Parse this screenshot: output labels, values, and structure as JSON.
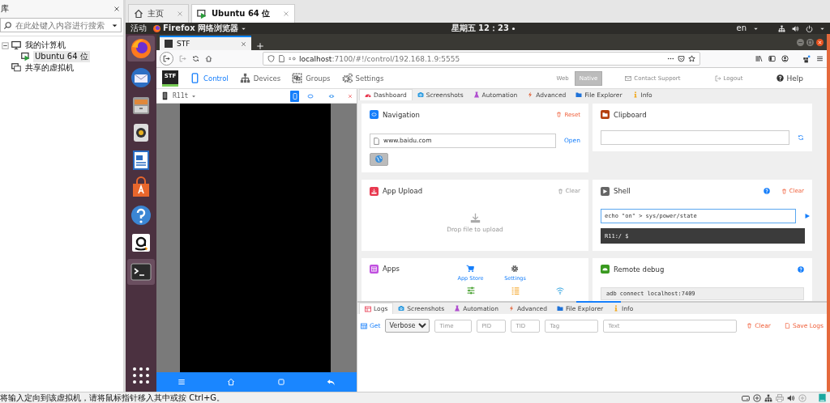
{
  "library": {
    "title": "库",
    "search": {
      "placeholder": "在此处键入内容进行搜索"
    },
    "tree": [
      {
        "label": "我的计算机",
        "kind": "computer",
        "expanded": true,
        "selected": false,
        "children": [
          {
            "label": "Ubuntu 64 位",
            "kind": "vm",
            "selected": true
          }
        ]
      },
      {
        "label": "共享的虚拟机",
        "kind": "shared",
        "selected": false
      }
    ]
  },
  "vm_tabs": [
    {
      "label": "主页",
      "kind": "home",
      "selected": false
    },
    {
      "label": "Ubuntu 64 位",
      "kind": "vm",
      "selected": true
    }
  ],
  "top_bar": {
    "activities": "活动",
    "app_menu": "Firefox 网络浏览器",
    "clock": "星期五 12：23",
    "language": "en"
  },
  "browser": {
    "tab": "STF",
    "url_host": "localhost",
    "url_path": ":7100/#!/control/192.168.1.9:5555"
  },
  "stf_header": {
    "logo": "STF",
    "nav": [
      {
        "label": "Control",
        "kind": "control",
        "selected": true
      },
      {
        "label": "Devices",
        "kind": "devices",
        "selected": false
      },
      {
        "label": "Groups",
        "kind": "groups",
        "selected": false
      },
      {
        "label": "Settings",
        "kind": "settings",
        "selected": false
      }
    ],
    "modes": [
      {
        "label": "Web",
        "selected": false
      },
      {
        "label": "Native",
        "selected": true
      }
    ],
    "contact": "Contact Support",
    "logout": "Logout",
    "help": "Help"
  },
  "device": {
    "name": "R11t"
  },
  "tabs": [
    {
      "label": "Dashboard",
      "kind": "dashboard",
      "selected": true
    },
    {
      "label": "Screenshots",
      "kind": "screenshots",
      "selected": false
    },
    {
      "label": "Automation",
      "kind": "automation",
      "selected": false
    },
    {
      "label": "Advanced",
      "kind": "advanced",
      "selected": false
    },
    {
      "label": "File Explorer",
      "kind": "files",
      "selected": false
    },
    {
      "label": "Info",
      "kind": "info",
      "selected": false
    }
  ],
  "navigation": {
    "title": "Navigation",
    "reset": "Reset",
    "url": "www.baidu.com",
    "open": "Open"
  },
  "clipboard": {
    "title": "Clipboard"
  },
  "app_upload": {
    "title": "App Upload",
    "clear": "Clear",
    "clear_disabled": true,
    "drop": "Drop file to upload"
  },
  "shell": {
    "title": "Shell",
    "clear": "Clear",
    "command": "echo \"on\" > sys/power/state",
    "output": "R11:/ $"
  },
  "apps": {
    "title": "Apps",
    "links": [
      {
        "label": "App Store",
        "kind": "store"
      },
      {
        "label": "Settings",
        "kind": "settings"
      }
    ]
  },
  "remote_debug": {
    "title": "Remote debug",
    "command": "adb connect localhost:7409"
  },
  "logs": {
    "tabs": [
      {
        "label": "Logs",
        "kind": "logs",
        "selected": true
      },
      {
        "label": "Screenshots",
        "kind": "screenshots",
        "selected": false
      },
      {
        "label": "Automation",
        "kind": "automation",
        "selected": false
      },
      {
        "label": "Advanced",
        "kind": "advanced",
        "selected": false
      },
      {
        "label": "File Explorer",
        "kind": "files",
        "selected": false
      },
      {
        "label": "Info",
        "kind": "info",
        "selected": false
      }
    ],
    "get": "Get",
    "level": "Verbose",
    "filters": [
      {
        "placeholder": "Time"
      },
      {
        "placeholder": "PID"
      },
      {
        "placeholder": "TID"
      },
      {
        "placeholder": "Tag"
      },
      {
        "placeholder": "Text"
      }
    ],
    "clear": "Clear",
    "save": "Save Logs"
  },
  "status_bar": {
    "message": "将输入定向到该虚拟机，请将鼠标指针移入其中或按 Ctrl+G。"
  }
}
